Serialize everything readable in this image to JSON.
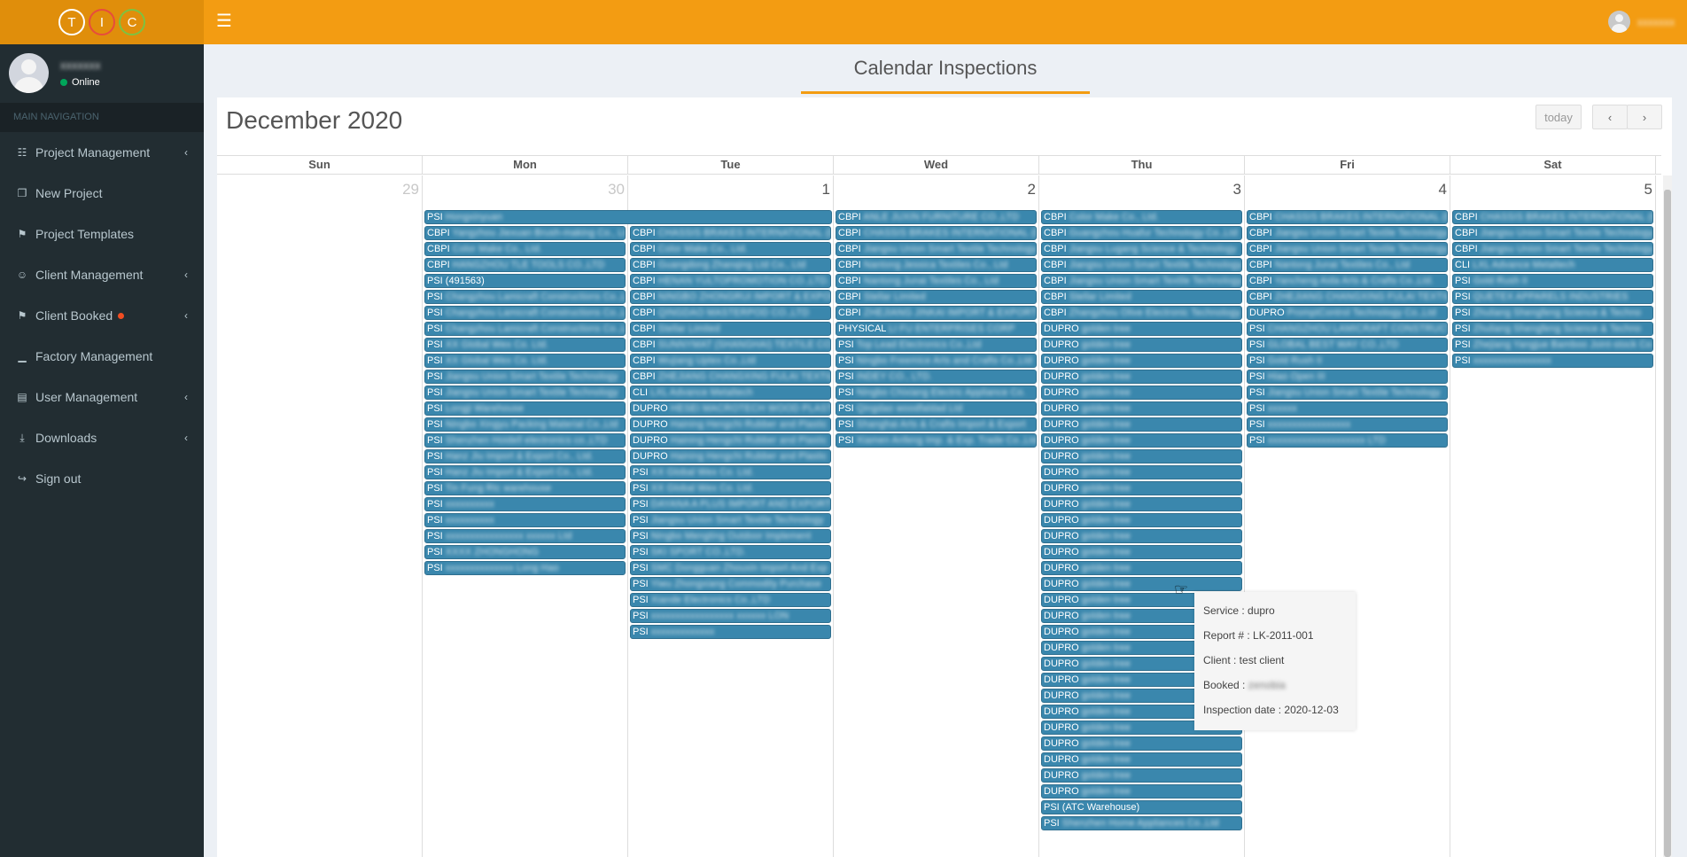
{
  "logo": {
    "letters": [
      "T",
      "I",
      "C"
    ]
  },
  "topbar": {
    "menu_icon": "hamburger-icon",
    "user_name": "xxxxxxx"
  },
  "user": {
    "name": "xxxxxxx",
    "status": "Online"
  },
  "nav": {
    "header": "MAIN NAVIGATION",
    "items": [
      {
        "label": "Project Management",
        "icon": "sitemap-icon",
        "caret": true
      },
      {
        "label": "New Project",
        "icon": "file-icon",
        "caret": false
      },
      {
        "label": "Project Templates",
        "icon": "bookmark-icon",
        "caret": false
      },
      {
        "label": "Client Management",
        "icon": "users-icon",
        "caret": true
      },
      {
        "label": "Client Booked",
        "icon": "bookmark-icon",
        "caret": true,
        "badge": true
      },
      {
        "label": "Factory Management",
        "icon": "chart-icon",
        "caret": false
      },
      {
        "label": "User Management",
        "icon": "id-card-icon",
        "caret": true
      },
      {
        "label": "Downloads",
        "icon": "download-icon",
        "caret": true
      },
      {
        "label": "Sign out",
        "icon": "sign-out-icon",
        "caret": false
      }
    ]
  },
  "page": {
    "title": "Calendar Inspections"
  },
  "calendar": {
    "title": "December 2020",
    "today_label": "today",
    "prev_label": "‹",
    "next_label": "›",
    "weekdays": [
      "Sun",
      "Mon",
      "Tue",
      "Wed",
      "Thu",
      "Fri",
      "Sat"
    ],
    "days": [
      {
        "num": "29",
        "other": true,
        "events": []
      },
      {
        "num": "30",
        "other": true,
        "events": [
          {
            "type": "PSI",
            "text": "Hongxinyuan",
            "span": 2
          },
          {
            "type": "CBPI",
            "text": "Yangzhou Jiexuan Brush-making Co., Ltd"
          },
          {
            "type": "CBPI",
            "text": "Color Make Co., Ltd."
          },
          {
            "type": "CBPI",
            "text": "HANGZHOU TLE TOOLS CO.,LTD"
          },
          {
            "type": "PSI",
            "text": "(491563)",
            "clear": true
          },
          {
            "type": "PSI",
            "text": "Changzhou Lamicraft Constructions Co.,Ltd"
          },
          {
            "type": "PSI",
            "text": "Changzhou Lamicraft Constructions Co.,Ltd"
          },
          {
            "type": "PSI",
            "text": "Changzhou Lamicraft Constructions Co.,Ltd"
          },
          {
            "type": "PSI",
            "text": "XX Global Wex Co. Ltd."
          },
          {
            "type": "PSI",
            "text": "XX Global Wex Co. Ltd."
          },
          {
            "type": "PSI",
            "text": "Jiangsu Union Smart Textile Technology"
          },
          {
            "type": "PSI",
            "text": "Jiangsu Union Smart Textile Technology"
          },
          {
            "type": "PSI",
            "text": "Longji Warehouse"
          },
          {
            "type": "PSI",
            "text": "Ningbo Xingyu Packing Material Co.,Ltd"
          },
          {
            "type": "PSI",
            "text": "Shenzhen Hoidell electronics co.,LTD"
          },
          {
            "type": "PSI",
            "text": "Hanz Jiu Import & Export Co., Ltd."
          },
          {
            "type": "PSI",
            "text": "Hanz Jiu Import & Export Co., Ltd."
          },
          {
            "type": "PSI",
            "text": "Tin Fung Rtc warehouse"
          },
          {
            "type": "PSI",
            "text": "xxxxxxxxxx"
          },
          {
            "type": "PSI",
            "text": "xxxxxxxxxx"
          },
          {
            "type": "PSI",
            "text": "xxxxxxxxxxxxxxxx xxxxxx Ltd"
          },
          {
            "type": "PSI",
            "text": "XXXX ZHONGHONG"
          },
          {
            "type": "PSI",
            "text": "xxxxxxxxxxxxxx Long Hao"
          }
        ]
      },
      {
        "num": "1",
        "other": false,
        "events": [
          {
            "type": "",
            "text": "",
            "placeholder": true
          },
          {
            "type": "CBPI",
            "text": "CHASSIS BRAKES INTERNATIONAL (DA)"
          },
          {
            "type": "CBPI",
            "text": "Color Make Co., Ltd."
          },
          {
            "type": "CBPI",
            "text": "Guangdong Zhanqing Ltd Co., Ltd"
          },
          {
            "type": "CBPI",
            "text": "HENAN YULTOPROMOTION CO.,LTD."
          },
          {
            "type": "CBPI",
            "text": "NINGBO ZHONGRUI IMPORT & EXPORT"
          },
          {
            "type": "CBPI",
            "text": "QINGDAO MASTERPOD CO.,LTD"
          },
          {
            "type": "CBPI",
            "text": "Stellar Limited"
          },
          {
            "type": "CBPI",
            "text": "SUNNYMAT (SHANGHAI) TEXTILE CO.,LTD"
          },
          {
            "type": "CBPI",
            "text": "Wujiang Uptex Co.,Ltd"
          },
          {
            "type": "CBPI",
            "text": "ZHEJIANG CHANGXING FULAI TEXTILE"
          },
          {
            "type": "CLI",
            "text": "LXL Advance Metaltech"
          },
          {
            "type": "DUPRO",
            "text": "HESEI MACROTECH WOOD PLASTIC"
          },
          {
            "type": "DUPRO",
            "text": "Haining Hengchi Rubber and Plastic"
          },
          {
            "type": "DUPRO",
            "text": "Haining Hengchi Rubber and Plastic"
          },
          {
            "type": "DUPRO",
            "text": "Haining Hengchi Rubber and Plastic"
          },
          {
            "type": "PSI",
            "text": "XX Global Wex Co. Ltd."
          },
          {
            "type": "PSI",
            "text": "XX Global Wex Co. Ltd."
          },
          {
            "type": "PSI",
            "text": "DAYANA A PLUS IMPORT AND EXPORT CO."
          },
          {
            "type": "PSI",
            "text": "Jiangsu Union Smart Textile Technology"
          },
          {
            "type": "PSI",
            "text": "Ningbo Mengting Outdoor Implement"
          },
          {
            "type": "PSI",
            "text": "SKI SPORT CO.,LTD."
          },
          {
            "type": "PSI",
            "text": "SMC Dongguan Zhouxin Import And Exp"
          },
          {
            "type": "PSI",
            "text": "Yiwu Zhongxiang Commodity Purchase"
          },
          {
            "type": "PSI",
            "text": "Xiande Electronics Co.,LTD"
          },
          {
            "type": "PSI",
            "text": "xxxxxxxxxxxxxxxxx xxxxxx LON"
          },
          {
            "type": "PSI",
            "text": "xxxxxxxxxxxxx"
          }
        ]
      },
      {
        "num": "2",
        "other": false,
        "events": [
          {
            "type": "CBPI",
            "text": "ANLE JUXIN FURNITURE CO.,LTD"
          },
          {
            "type": "CBPI",
            "text": "CHASSIS BRAKES INTERNATIONAL (DA)"
          },
          {
            "type": "CBPI",
            "text": "Jiangsu Union Smart Textile Technology"
          },
          {
            "type": "CBPI",
            "text": "Nantong Jessica Textiles Co., Ltd"
          },
          {
            "type": "CBPI",
            "text": "Nantong Junai Textiles Co., Ltd"
          },
          {
            "type": "CBPI",
            "text": "Stellar Limited"
          },
          {
            "type": "CBPI",
            "text": "ZHEJIANG JINKAI IMPORT & EXPORT"
          },
          {
            "type": "PHYSICAL",
            "text": "LI FU ENTERPRISES CORP"
          },
          {
            "type": "PSI",
            "text": "Top Lead Electronics Co.,Ltd"
          },
          {
            "type": "PSI",
            "text": "Ningbo Freemice Arts and Crafts Co.,Ltd"
          },
          {
            "type": "PSI",
            "text": "INDEY CO., LTD."
          },
          {
            "type": "PSI",
            "text": "Ningbo Chixiang Electric Appliance Co."
          },
          {
            "type": "PSI",
            "text": "Qingdao woodfaldad Ltd"
          },
          {
            "type": "PSI",
            "text": "Shanghai Arts & Crafts Import & Export"
          },
          {
            "type": "PSI",
            "text": "Xiamen Anfeng Imp. & Exp. Trade Co.,Ltd"
          }
        ]
      },
      {
        "num": "3",
        "other": false,
        "events": [
          {
            "type": "CBPI",
            "text": "Color Make Co., Ltd."
          },
          {
            "type": "CBPI",
            "text": "Guangzhou Huafur Technology Co.,Ltd"
          },
          {
            "type": "CBPI",
            "text": "Jiangsu Lugang Science & Technology"
          },
          {
            "type": "CBPI",
            "text": "Jiangsu Union Smart Textile Technology"
          },
          {
            "type": "CBPI",
            "text": "Jiangsu Union Smart Textile Technology"
          },
          {
            "type": "CBPI",
            "text": "Stellar Limited"
          },
          {
            "type": "CBPI",
            "text": "Zhangzhou Olive Electronic Technology"
          },
          {
            "type": "DUPRO",
            "text": "golden tree"
          },
          {
            "type": "DUPRO",
            "text": "golden tree"
          },
          {
            "type": "DUPRO",
            "text": "golden tree"
          },
          {
            "type": "DUPRO",
            "text": "golden tree"
          },
          {
            "type": "DUPRO",
            "text": "golden tree"
          },
          {
            "type": "DUPRO",
            "text": "golden tree"
          },
          {
            "type": "DUPRO",
            "text": "golden tree"
          },
          {
            "type": "DUPRO",
            "text": "golden tree"
          },
          {
            "type": "DUPRO",
            "text": "golden tree"
          },
          {
            "type": "DUPRO",
            "text": "golden tree"
          },
          {
            "type": "DUPRO",
            "text": "golden tree"
          },
          {
            "type": "DUPRO",
            "text": "golden tree"
          },
          {
            "type": "DUPRO",
            "text": "golden tree"
          },
          {
            "type": "DUPRO",
            "text": "golden tree"
          },
          {
            "type": "DUPRO",
            "text": "golden tree"
          },
          {
            "type": "DUPRO",
            "text": "golden tree"
          },
          {
            "type": "DUPRO",
            "text": "golden tree"
          },
          {
            "type": "DUPRO",
            "text": "golden tree"
          },
          {
            "type": "DUPRO",
            "text": "golden tree"
          },
          {
            "type": "DUPRO",
            "text": "golden tree"
          },
          {
            "type": "DUPRO",
            "text": "golden tree"
          },
          {
            "type": "DUPRO",
            "text": "golden tree"
          },
          {
            "type": "DUPRO",
            "text": "golden tree"
          },
          {
            "type": "DUPRO",
            "text": "golden tree"
          },
          {
            "type": "DUPRO",
            "text": "golden tree"
          },
          {
            "type": "DUPRO",
            "text": "golden tree"
          },
          {
            "type": "DUPRO",
            "text": "golden tree"
          },
          {
            "type": "DUPRO",
            "text": "golden tree"
          },
          {
            "type": "DUPRO",
            "text": "golden tree"
          },
          {
            "type": "DUPRO",
            "text": "golden tree"
          },
          {
            "type": "PSI",
            "text": "(ATC Warehouse)",
            "partial": true
          },
          {
            "type": "PSI",
            "text": "Shenzhen Home Appliances Co.,Ltd"
          }
        ]
      },
      {
        "num": "4",
        "other": false,
        "events": [
          {
            "type": "CBPI",
            "text": "CHASSIS BRAKES INTERNATIONAL (DA)"
          },
          {
            "type": "CBPI",
            "text": "Jiangsu Union Smart Textile Technology"
          },
          {
            "type": "CBPI",
            "text": "Jiangsu Union Smart Textile Technology"
          },
          {
            "type": "CBPI",
            "text": "Nantong Junai Textiles Co., Ltd"
          },
          {
            "type": "CBPI",
            "text": "Yancheng Aida Arts & Crafts Co.,Ltd."
          },
          {
            "type": "CBPI",
            "text": "ZHEJIANG CHANGXING FULAI TEXTILE"
          },
          {
            "type": "DUPRO",
            "text": "PromptControl Technology Co.,Ltd"
          },
          {
            "type": "PSI",
            "text": "CHANGZHOU LAMICRAFT CONSTRUCTION"
          },
          {
            "type": "PSI",
            "text": "GLOBAL BEST WAY CO.,LTD"
          },
          {
            "type": "PSI",
            "text": "Gold Rush II"
          },
          {
            "type": "PSI",
            "text": "Hiao Open III"
          },
          {
            "type": "PSI",
            "text": "Jiangsu Union Smart Textile Technology"
          },
          {
            "type": "PSI",
            "text": "xxxxxx"
          },
          {
            "type": "PSI",
            "text": "xxxxxxxxxxxxxxxxx"
          },
          {
            "type": "PSI",
            "text": "xxxxxxxxxxxxxxxxxxxx LTD"
          }
        ]
      },
      {
        "num": "5",
        "other": false,
        "events": [
          {
            "type": "CBPI",
            "text": "CHASSIS BRAKES INTERNATIONAL (DA)"
          },
          {
            "type": "CBPI",
            "text": "Jiangsu Union Smart Textile Technology"
          },
          {
            "type": "CBPI",
            "text": "Jiangsu Union Smart Textile Technology"
          },
          {
            "type": "CLI",
            "text": "LXL Advance Metaltech"
          },
          {
            "type": "PSI",
            "text": "Gold Rush II"
          },
          {
            "type": "PSI",
            "text": "QUETEX APPARELS INDUSTRIES"
          },
          {
            "type": "PSI",
            "text": "Zhuliang Shengfeng Science & Techno"
          },
          {
            "type": "PSI",
            "text": "Zhuliang Shengfeng Science & Techno"
          },
          {
            "type": "PSI",
            "text": "Zhejiang Yangjue Bamboo Joint-stock Co"
          },
          {
            "type": "PSI",
            "text": "xxxxxxxxxxxxxxxx"
          }
        ]
      }
    ]
  },
  "tooltip": {
    "service": "Service : dupro",
    "report": "Report # : LK-2011-001",
    "client": "Client : test client",
    "booked_label": "Booked :",
    "booked_value": "zenobia",
    "date": "Inspection date : 2020-12-03"
  }
}
